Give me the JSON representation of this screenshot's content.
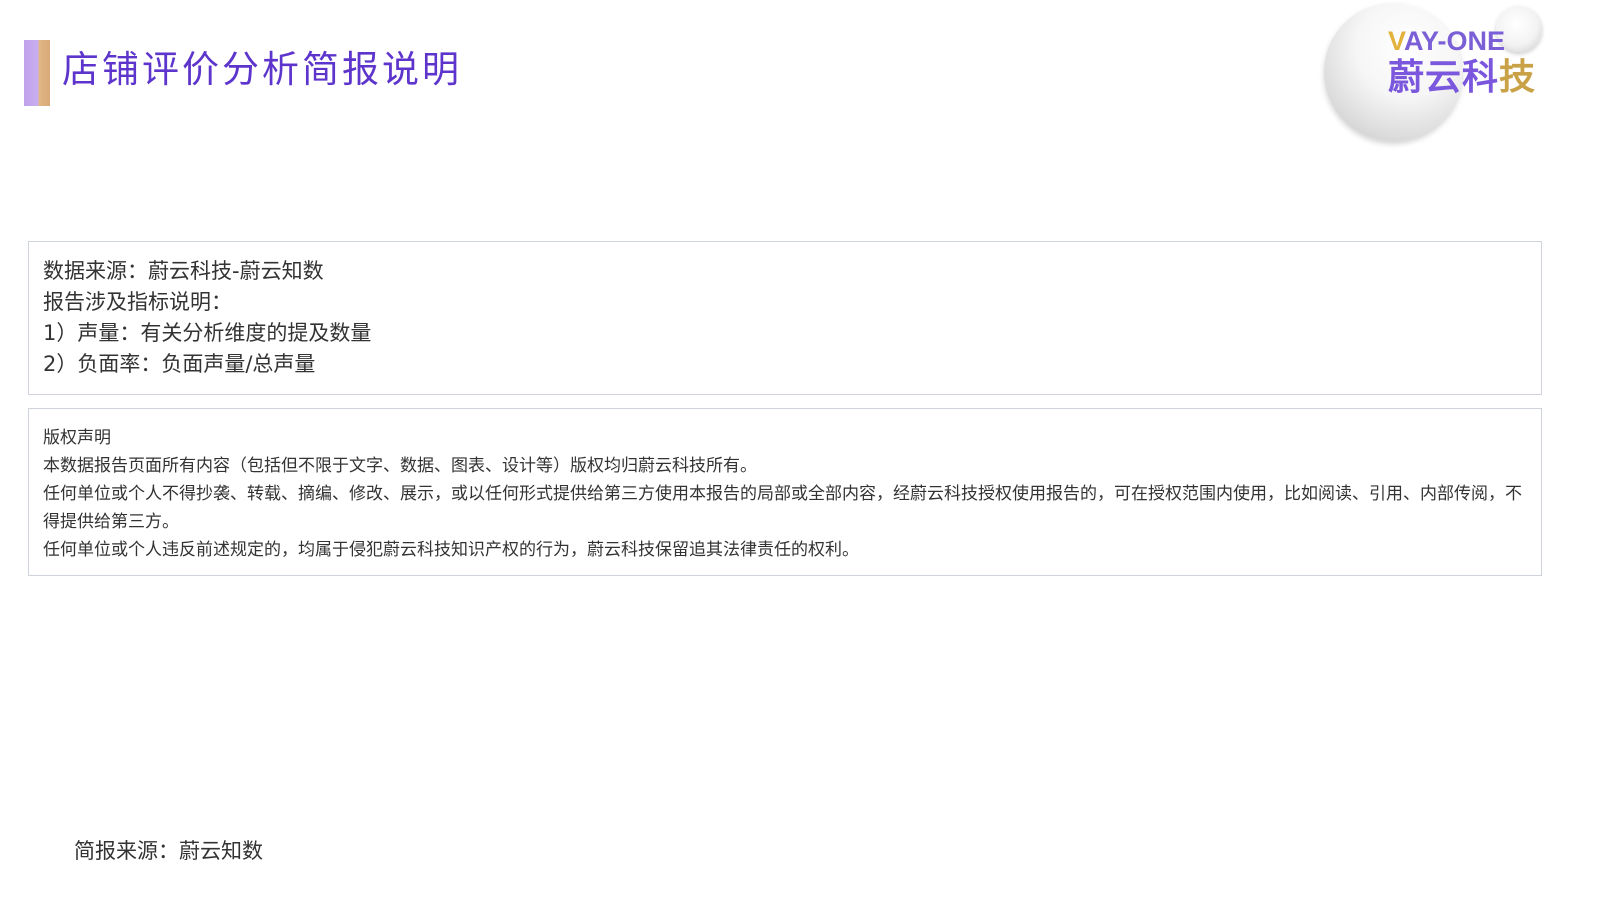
{
  "header": {
    "title": "店铺评价分析简报说明"
  },
  "logo": {
    "en_first": "V",
    "en_rest": "AY-ONE",
    "cn_main": "蔚云科",
    "cn_last": "技"
  },
  "info": {
    "lines": [
      "数据来源：蔚云科技-蔚云知数",
      "报告涉及指标说明：",
      "1）声量：有关分析维度的提及数量",
      "2）负面率：负面声量/总声量"
    ]
  },
  "copyright": {
    "heading": "版权声明",
    "paragraphs": [
      "本数据报告页面所有内容（包括但不限于文字、数据、图表、设计等）版权均归蔚云科技所有。",
      "任何单位或个人不得抄袭、转载、摘编、修改、展示，或以任何形式提供给第三方使用本报告的局部或全部内容，经蔚云科技授权使用报告的，可在授权范围内使用，比如阅读、引用、内部传阅，不得提供给第三方。",
      "任何单位或个人违反前述规定的，均属于侵犯蔚云科技知识产权的行为，蔚云科技保留追其法律责任的权利。"
    ]
  },
  "footer": {
    "source": "简报来源：蔚云知数"
  },
  "colors": {
    "title": "#5d35cc",
    "accent_purple": "#bfa2ea",
    "accent_gold": "#e2b887",
    "logo_purple": "#7a57dc",
    "logo_gold": "#e3b23c",
    "border": "#cfd3dc",
    "text": "#333333"
  }
}
